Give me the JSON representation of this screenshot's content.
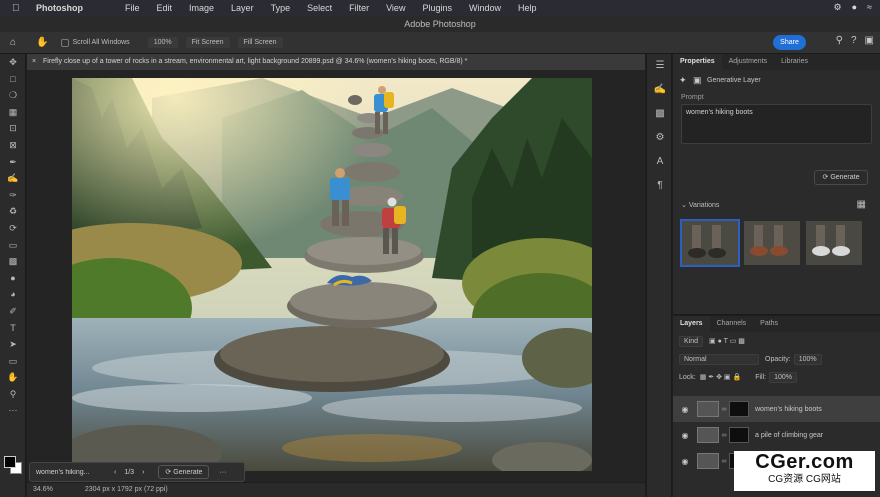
{
  "menubar": {
    "app_name": "Photoshop",
    "items": [
      "File",
      "Edit",
      "Image",
      "Layer",
      "Type",
      "Select",
      "Filter",
      "View",
      "Plugins",
      "Window",
      "Help"
    ],
    "apple_icon": "apple-icon",
    "status_icons": [
      "control-center-icon",
      "siri-icon",
      "wifi-icon"
    ]
  },
  "window": {
    "title": "Adobe Photoshop"
  },
  "options_bar": {
    "scroll_all_windows": "Scroll All Windows",
    "zoom_100": "100%",
    "fit_screen": "Fit Screen",
    "fill_screen": "Fill Screen",
    "share": "Share"
  },
  "document": {
    "tab_title": "Firefly close up of a tower of rocks in a stream, environmental art, light background 20899.psd @ 34.6% (women's hiking boots, RGB/8) *"
  },
  "generative_bar": {
    "prompt": "women's hiking...",
    "count": "1/3",
    "generate": "Generate",
    "more": "···"
  },
  "statusbar": {
    "zoom": "34.6%",
    "dims": "2304 px x 1792 px (72 ppi)"
  },
  "properties": {
    "tabs": [
      "Properties",
      "Adjustments",
      "Libraries"
    ],
    "layer_type": "Generative Layer",
    "prompt_label": "Prompt",
    "prompt_value": "women's hiking boots",
    "generate": "Generate",
    "variations_label": "Variations"
  },
  "layers": {
    "tabs": [
      "Layers",
      "Channels",
      "Paths"
    ],
    "kind": "Kind",
    "blend_mode": "Normal",
    "opacity_label": "Opacity:",
    "opacity_value": "100%",
    "lock_label": "Lock:",
    "fill_label": "Fill:",
    "fill_value": "100%",
    "items": [
      {
        "name": "women's hiking boots"
      },
      {
        "name": "a pile of climbing gear"
      },
      {
        "name": ""
      }
    ]
  },
  "watermark": {
    "main": "CGer.com",
    "sub": "CG资源 CG网站"
  },
  "colors": {
    "accent": "#1f6fd6",
    "selection": "#2d5fbf",
    "hiker_shirt_blue": "#3a8fd0",
    "backpack_yellow": "#e6b520"
  }
}
